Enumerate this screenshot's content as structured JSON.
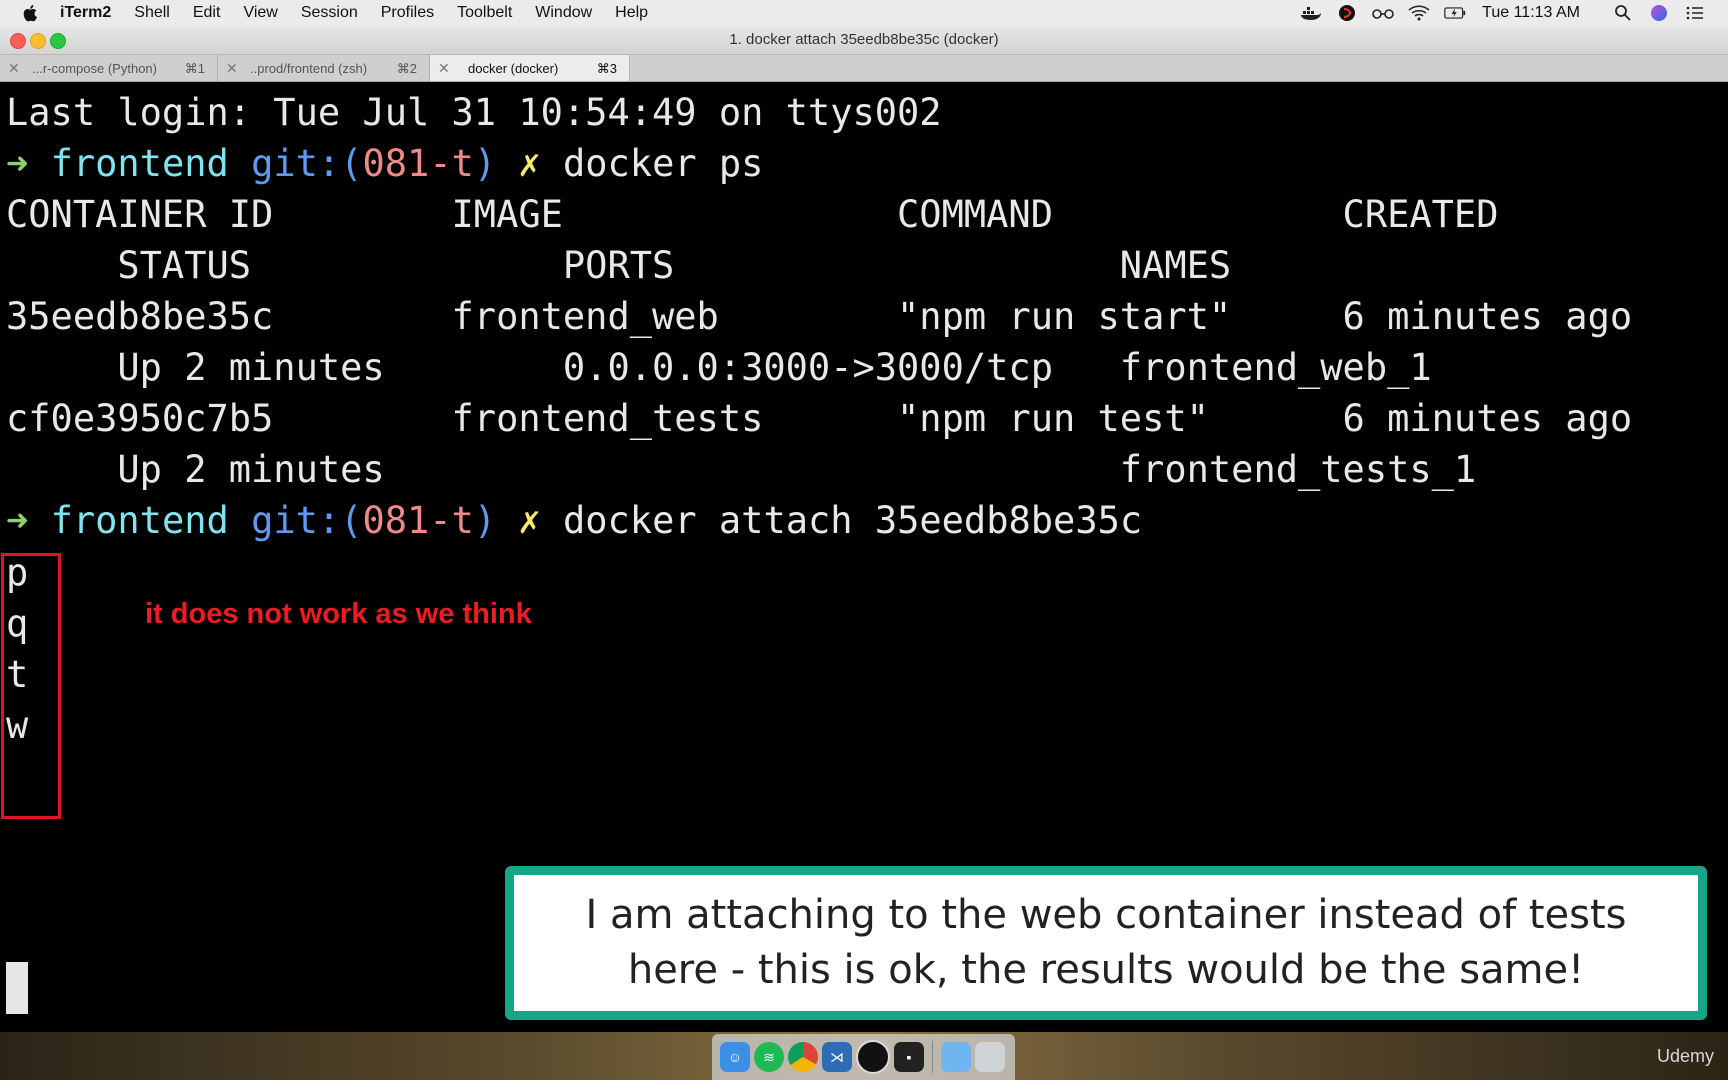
{
  "menubar": {
    "items": [
      "iTerm2",
      "Shell",
      "Edit",
      "View",
      "Session",
      "Profiles",
      "Toolbelt",
      "Window",
      "Help"
    ],
    "clock": "Tue 11:13 AM",
    "status_icons": [
      "docker-icon",
      "app-icon",
      "glasses-icon",
      "wifi-icon",
      "battery-icon"
    ]
  },
  "window": {
    "title": "1. docker attach 35eedb8be35c (docker)"
  },
  "tabs": [
    {
      "label": "...r-compose (Python)",
      "shortcut": "⌘1"
    },
    {
      "label": "..prod/frontend (zsh)",
      "shortcut": "⌘2"
    },
    {
      "label": "docker (docker)",
      "shortcut": "⌘3"
    }
  ],
  "terminal": {
    "login": "Last login: Tue Jul 31 10:54:49 on ttys002",
    "prompt": {
      "arrow": "➜",
      "dir": "frontend",
      "git_open": "git:(",
      "branch": "081-t",
      "git_close": ")",
      "dirty": "✗"
    },
    "cmd1": "docker ps",
    "header1": "CONTAINER ID        IMAGE               COMMAND             CREATED",
    "header2": "     STATUS              PORTS                    NAMES",
    "row1a": "35eedb8be35c        frontend_web        \"npm run start\"     6 minutes ago",
    "row1b": "     Up 2 minutes        0.0.0.0:3000->3000/tcp   frontend_web_1",
    "row2a": "cf0e3950c7b5        frontend_tests      \"npm run test\"      6 minutes ago",
    "row2b": "     Up 2 minutes                                 frontend_tests_1",
    "cmd2": "docker attach 35eedb8be35c",
    "typed": [
      "p",
      "q",
      "t",
      "w"
    ]
  },
  "annotation": "it does not work as we think",
  "callout": {
    "line1": "I am attaching to the web container instead of tests",
    "line2": "here - this is ok, the results would be the same!"
  },
  "watermark": "Udemy",
  "colors": {
    "accent": "#17a589",
    "annotation": "#ee1b24"
  }
}
